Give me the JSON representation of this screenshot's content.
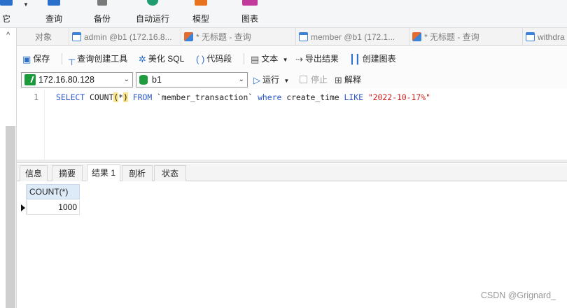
{
  "ribbon": {
    "items": [
      {
        "label": "它",
        "icon": "cube-icon",
        "color": "#2a6fc9"
      },
      {
        "label": "查询",
        "icon": "query-icon",
        "color": "#2a6fc9"
      },
      {
        "label": "备份",
        "icon": "backup-icon",
        "color": "#7a7a7a"
      },
      {
        "label": "自动运行",
        "icon": "automation-icon",
        "color": "#1f9d6e"
      },
      {
        "label": "模型",
        "icon": "model-icon",
        "color": "#e8731f"
      },
      {
        "label": "图表",
        "icon": "chart-icon",
        "color": "#c0399b"
      }
    ]
  },
  "tabs": [
    {
      "label": "对象",
      "icon": ""
    },
    {
      "label": "admin @b1 (172.16.8...",
      "icon": "table-icon"
    },
    {
      "label": "* 无标题 - 查询",
      "icon": "query-tab-icon"
    },
    {
      "label": "member @b1 (172.1...",
      "icon": "table-icon"
    },
    {
      "label": "* 无标题 - 查询",
      "icon": "query-tab-icon"
    },
    {
      "label": "withdra",
      "icon": "table-icon"
    }
  ],
  "toolbar": {
    "save": "保存",
    "query_builder": "查询创建工具",
    "beautify": "美化 SQL",
    "snippet": "代码段",
    "text": "文本",
    "export": "导出结果",
    "create_chart": "创建图表"
  },
  "connection": {
    "host": "172.16.80.128",
    "database": "b1",
    "run": "运行",
    "stop": "停止",
    "explain": "解释"
  },
  "editor": {
    "line_number": "1",
    "tokens": {
      "select": "SELECT",
      "count": "COUNT",
      "open_paren": "(",
      "star": "*",
      "close_paren": ")",
      "from": "FROM",
      "table": "`member_transaction`",
      "where": "where",
      "column": "create_time",
      "like": "LIKE",
      "pattern": "\"2022-10-17%\""
    }
  },
  "result_tabs": [
    "信息",
    "摘要",
    "结果 1",
    "剖析",
    "状态"
  ],
  "active_result_tab": "结果 1",
  "grid": {
    "column_header": "COUNT(*)",
    "rows": [
      [
        "1000"
      ]
    ]
  },
  "watermark": "CSDN @Grignard_"
}
